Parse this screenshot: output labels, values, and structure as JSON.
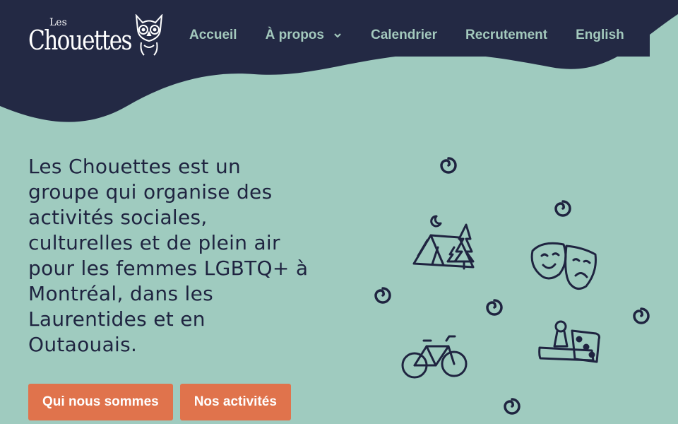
{
  "logo": {
    "small": "Les",
    "big": "Chouettes"
  },
  "nav": {
    "items": [
      {
        "label": "Accueil"
      },
      {
        "label": "À propos",
        "has_dropdown": true
      },
      {
        "label": "Calendrier"
      },
      {
        "label": "Recrutement"
      },
      {
        "label": "English"
      }
    ]
  },
  "intro": {
    "text": "Les Chouettes est un groupe qui organise des activités sociales, culturelles et de plein air pour les femmes LGBTQ+ à Montréal, dans les Laurentides et en Outaouais."
  },
  "buttons": {
    "about": "Qui nous sommes",
    "activities": "Nos activités"
  },
  "colors": {
    "background": "#9fcbbf",
    "header": "#232944",
    "nav_text": "#a3c9bd",
    "accent": "#e0734c",
    "text": "#1f2440"
  },
  "icons": [
    "owl-icon",
    "chevron-down-icon",
    "tent-icon",
    "tree-icon",
    "moon-icon",
    "theater-masks-icon",
    "bicycle-icon",
    "board-game-icon",
    "swirl-icon"
  ]
}
